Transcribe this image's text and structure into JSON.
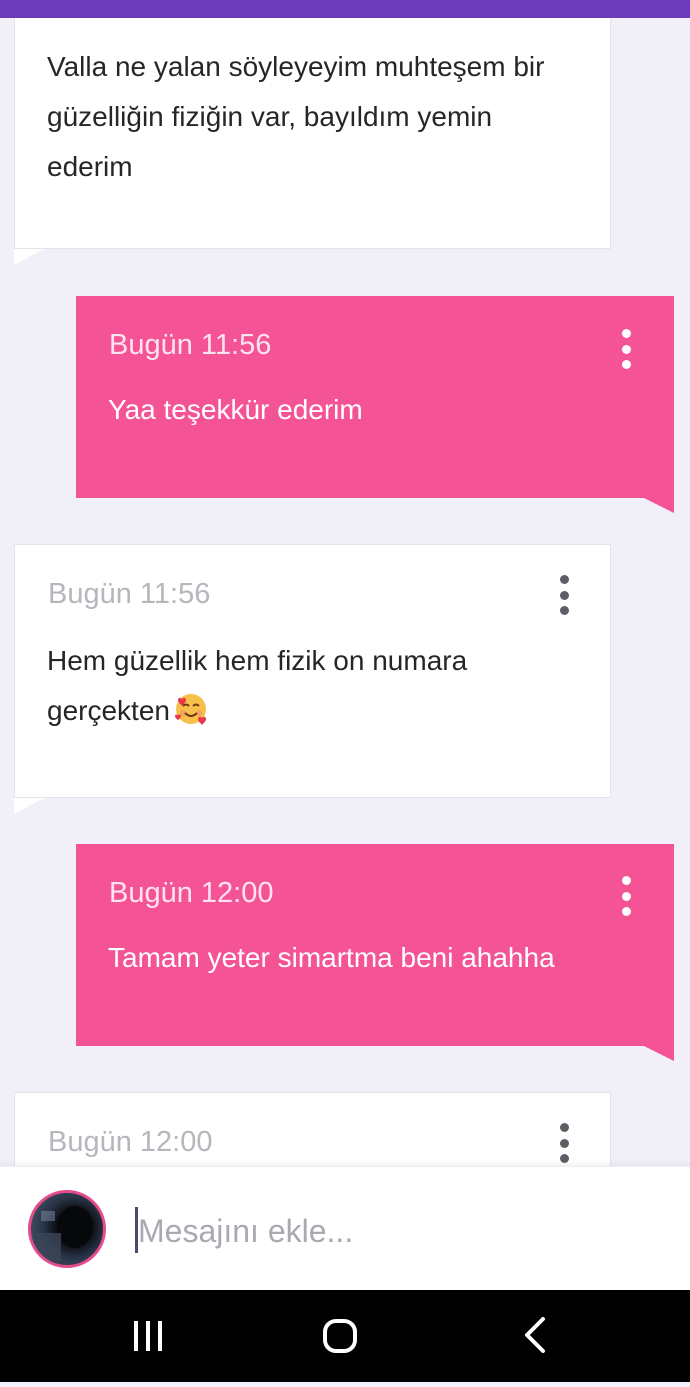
{
  "messages": [
    {
      "direction": "incoming",
      "time": "",
      "text": "Valla ne yalan söyleyeyim muhteşem bir güzelliğin fiziğin var, bayıldım yemin ederim"
    },
    {
      "direction": "outgoing",
      "time": "Bugün 11:56",
      "text": "Yaa teşekkür ederim"
    },
    {
      "direction": "incoming",
      "time": "Bugün 11:56",
      "text_lines": [
        "Hem güzellik hem fizik on numara",
        "gerçekten"
      ],
      "emoji": "smiling-face-with-hearts-icon"
    },
    {
      "direction": "outgoing",
      "time": "Bugün 12:00",
      "text": "Tamam yeter simartma beni ahahha"
    },
    {
      "direction": "incoming",
      "time": "Bugün 12:00",
      "text": ""
    }
  ],
  "composer": {
    "placeholder": "Mesajını ekle...",
    "value": "",
    "avatar_icon": "user-avatar"
  },
  "navigation_bar": {
    "buttons": [
      "recent-apps-icon",
      "home-icon",
      "back-icon"
    ]
  },
  "colors": {
    "header": "#6a3cbc",
    "outgoing_bubble": "#f45396",
    "incoming_bubble": "#ffffff",
    "background": "#f1f0f8"
  }
}
